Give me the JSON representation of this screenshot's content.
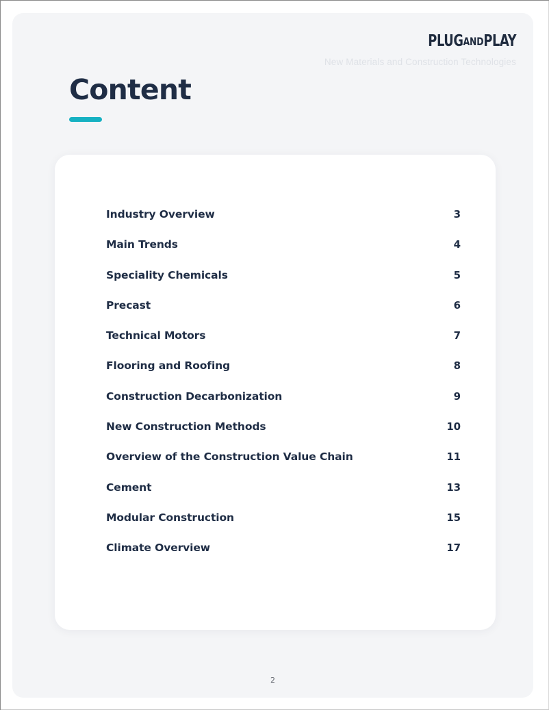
{
  "header": {
    "logo_primary_a": "PLUG",
    "logo_and": "AND",
    "logo_primary_b": "PLAY",
    "subtitle": "New Materials and Construction Technologies"
  },
  "title": {
    "heading": "Content"
  },
  "toc": {
    "entries": [
      {
        "title": "Industry Overview",
        "page": "3"
      },
      {
        "title": "Main Trends",
        "page": "4"
      },
      {
        "title": "Speciality Chemicals",
        "page": "5"
      },
      {
        "title": "Precast",
        "page": "6"
      },
      {
        "title": "Technical Motors",
        "page": "7"
      },
      {
        "title": "Flooring and Roofing",
        "page": "8"
      },
      {
        "title": "Construction Decarbonization",
        "page": "9"
      },
      {
        "title": "New Construction Methods",
        "page": "10"
      },
      {
        "title": "Overview of the Construction Value Chain",
        "page": "11"
      },
      {
        "title": "Cement",
        "page": "13"
      },
      {
        "title": "Modular Construction",
        "page": "15"
      },
      {
        "title": "Climate Overview",
        "page": "17"
      }
    ]
  },
  "footer": {
    "page_number": "2"
  },
  "colors": {
    "navy": "#1f2d45",
    "accent_teal": "#16b1c2",
    "page_background": "#f4f5f7",
    "card_background": "#ffffff",
    "subtitle_gray": "#dfe2e7"
  }
}
